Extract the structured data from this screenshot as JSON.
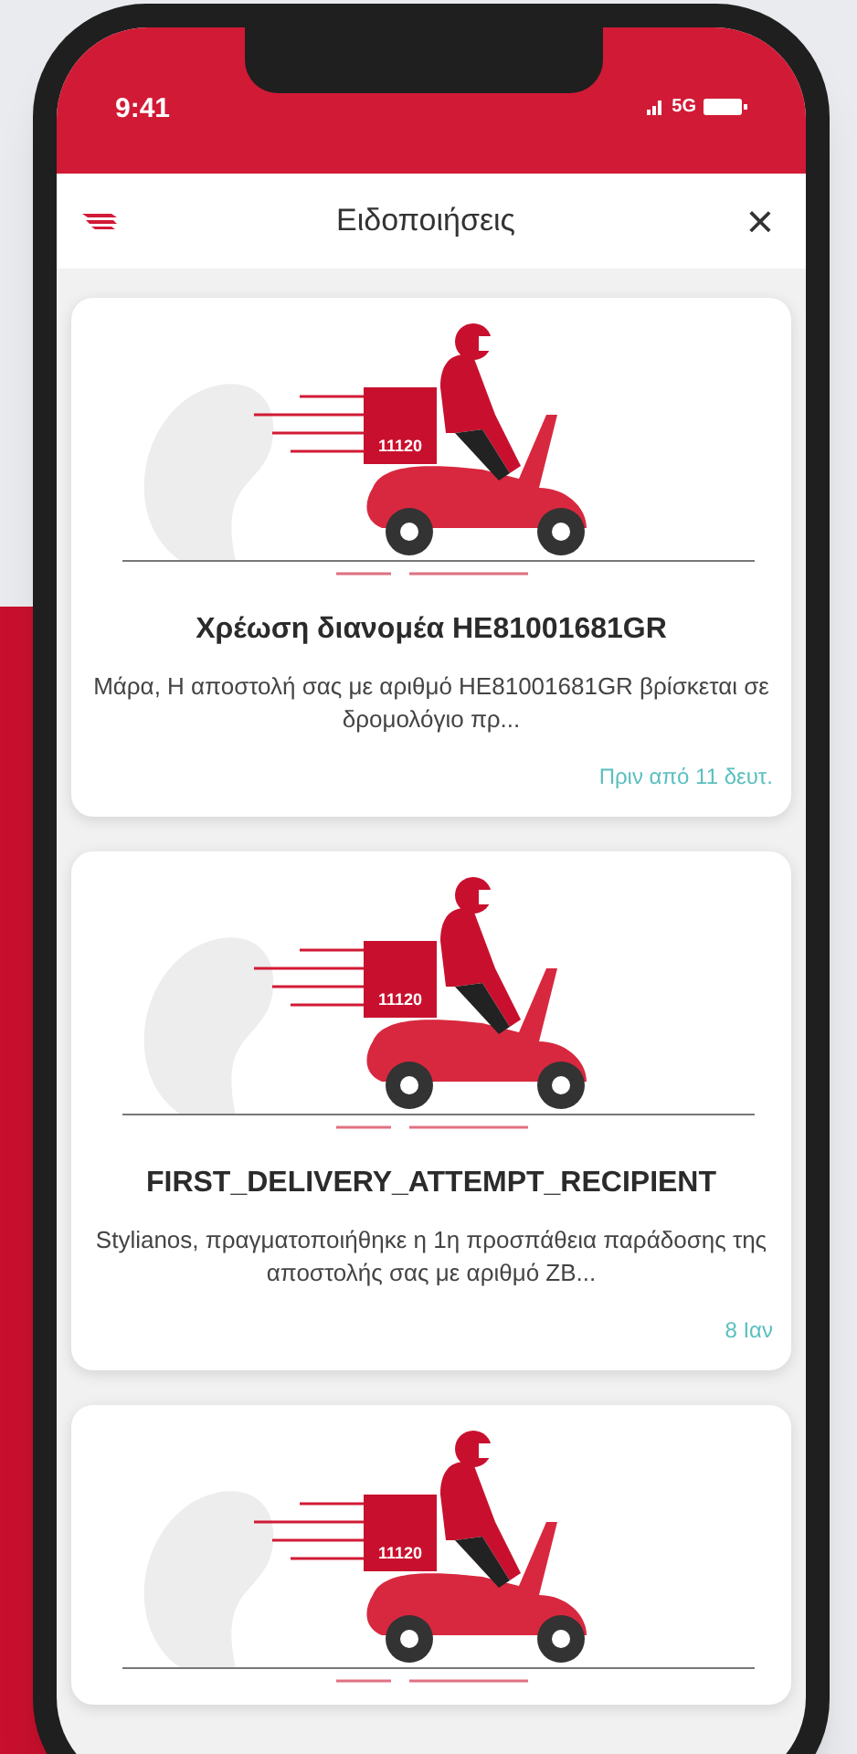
{
  "status_bar": {
    "time": "9:41",
    "network": "5G"
  },
  "header": {
    "title": "Ειδοποιήσεις",
    "close": "×"
  },
  "notifications": [
    {
      "box_label": "11120",
      "title": "Χρέωση διανομέα HE81001681GR",
      "message": "Μάρα, Η αποστολή σας με αριθμό HE81001681GR βρίσκεται σε δρομολόγιο πρ...",
      "time": "Πριν από 11 δευτ."
    },
    {
      "box_label": "11120",
      "title": "FIRST_DELIVERY_ATTEMPT_RECIPIENT",
      "message": "Stylianos, πραγματοποιήθηκε η 1η προσπάθεια παράδοσης της αποστολής σας με αριθμό ΖΒ...",
      "time": "8 Ιαν"
    },
    {
      "box_label": "11120"
    }
  ]
}
